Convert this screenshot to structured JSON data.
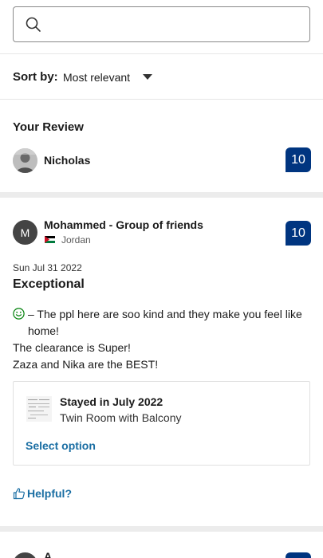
{
  "search": {
    "placeholder": "",
    "value": ""
  },
  "sort": {
    "label": "Sort by:",
    "value": "Most relevant"
  },
  "your_review": {
    "title": "Your Review",
    "name": "Nicholas",
    "score": "10"
  },
  "review": {
    "avatar_letter": "M",
    "name": "Mohammed - Group of friends",
    "country": "Jordan",
    "score": "10",
    "date": "Sun Jul 31 2022",
    "title": "Exceptional",
    "body_line1": "– The ppl here are soo kind and they make you feel like home!",
    "body_line2": "The clearance is Super!",
    "body_line3": "Zaza and Nika are the BEST!",
    "stayed": "Stayed in July 2022",
    "room": "Twin Room with Balcony",
    "select_option": "Select option",
    "helpful": "Helpful?"
  },
  "next_review": {
    "name": "A..."
  },
  "colors": {
    "brand_blue": "#003580",
    "link_blue": "#1a6ea3",
    "divider": "#ececec"
  }
}
